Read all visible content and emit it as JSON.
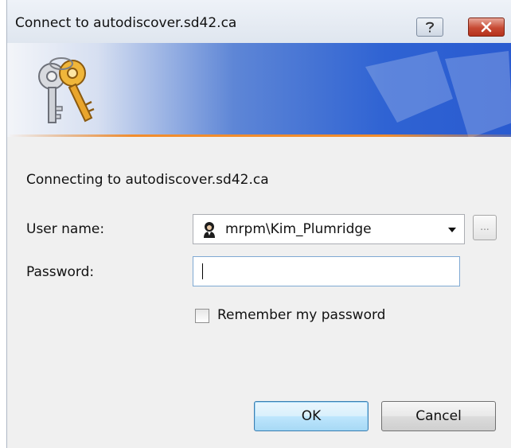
{
  "window": {
    "title": "Connect to autodiscover.sd42.ca",
    "help_icon": "question-mark-icon",
    "close_icon": "close-x-icon"
  },
  "banner": {
    "icon": "keys-icon",
    "accent_color": "#f28d2d",
    "blue_color": "#2f63d3"
  },
  "body": {
    "connecting_text": "Connecting to autodiscover.sd42.ca",
    "user_label": "User name:",
    "user_value": "mrpm\\Kim_Plumridge",
    "user_icon": "user-avatar-icon",
    "browse_label": "...",
    "password_label": "Password:",
    "password_value": "",
    "remember_label": "Remember my password",
    "remember_checked": false
  },
  "buttons": {
    "ok_label": "OK",
    "cancel_label": "Cancel"
  }
}
